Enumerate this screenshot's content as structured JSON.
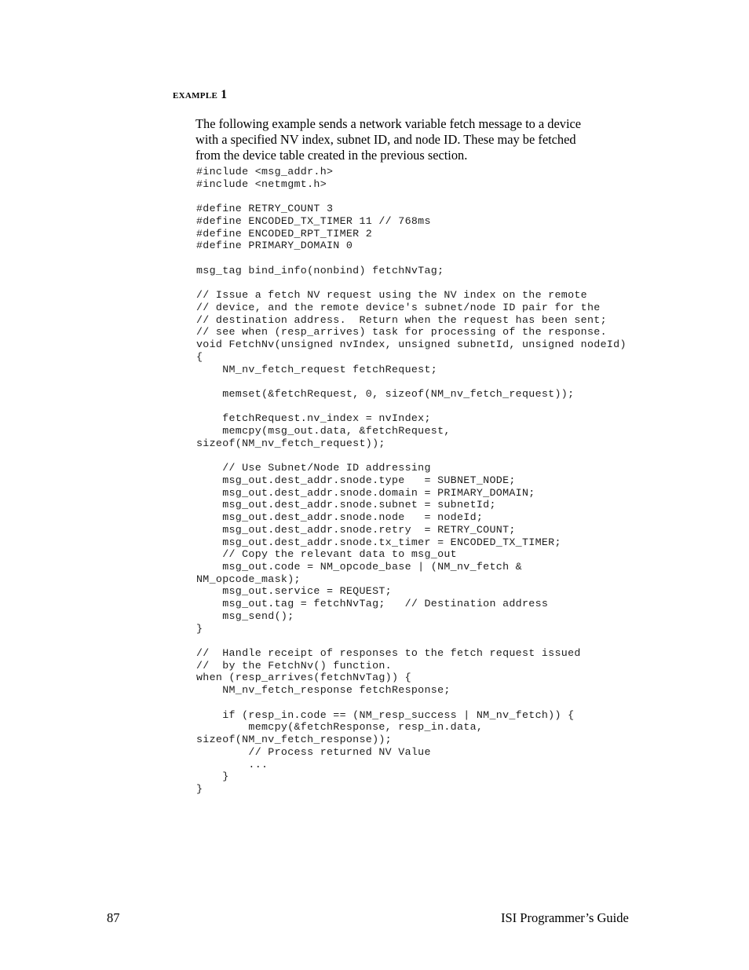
{
  "document": {
    "heading": "Example 1",
    "intro_paragraph": "The following example sends a network variable fetch message to a device\nwith a specified NV index, subnet ID, and node ID.  These may be fetched\nfrom the device table created in the previous section.",
    "code_lines": [
      "#include <msg_addr.h>",
      "#include <netmgmt.h>",
      "",
      "#define RETRY_COUNT 3",
      "#define ENCODED_TX_TIMER 11 // 768ms",
      "#define ENCODED_RPT_TIMER 2",
      "#define PRIMARY_DOMAIN 0",
      "",
      "msg_tag bind_info(nonbind) fetchNvTag;",
      "",
      "// Issue a fetch NV request using the NV index on the remote",
      "// device, and the remote device's subnet/node ID pair for the",
      "// destination address.  Return when the request has been sent;",
      "// see when (resp_arrives) task for processing of the response.",
      "void FetchNv(unsigned nvIndex, unsigned subnetId, unsigned nodeId)",
      "{",
      "    NM_nv_fetch_request fetchRequest;",
      "",
      "    memset(&fetchRequest, 0, sizeof(NM_nv_fetch_request));",
      "",
      "    fetchRequest.nv_index = nvIndex;",
      "    memcpy(msg_out.data, &fetchRequest,",
      "sizeof(NM_nv_fetch_request));",
      "",
      "    // Use Subnet/Node ID addressing",
      "    msg_out.dest_addr.snode.type   = SUBNET_NODE;",
      "    msg_out.dest_addr.snode.domain = PRIMARY_DOMAIN;",
      "    msg_out.dest_addr.snode.subnet = subnetId;",
      "    msg_out.dest_addr.snode.node   = nodeId;",
      "    msg_out.dest_addr.snode.retry  = RETRY_COUNT;",
      "    msg_out.dest_addr.snode.tx_timer = ENCODED_TX_TIMER;",
      "    // Copy the relevant data to msg_out",
      "    msg_out.code = NM_opcode_base | (NM_nv_fetch &",
      "NM_opcode_mask);",
      "    msg_out.service = REQUEST;",
      "    msg_out.tag = fetchNvTag;   // Destination address",
      "    msg_send();",
      "}",
      "",
      "//  Handle receipt of responses to the fetch request issued",
      "//  by the FetchNv() function.",
      "when (resp_arrives(fetchNvTag)) {",
      "    NM_nv_fetch_response fetchResponse;",
      "",
      "    if (resp_in.code == (NM_resp_success | NM_nv_fetch)) {",
      "        memcpy(&fetchResponse, resp_in.data,",
      "sizeof(NM_nv_fetch_response));",
      "        // Process returned NV Value",
      "        ...",
      "    }",
      "}"
    ]
  },
  "footer": {
    "page_number": "87",
    "doc_title": "ISI Programmer’s Guide"
  },
  "colors": {
    "page_background": "#ffffff",
    "body_text": "#000000",
    "code_text": "#1c1c1c"
  }
}
